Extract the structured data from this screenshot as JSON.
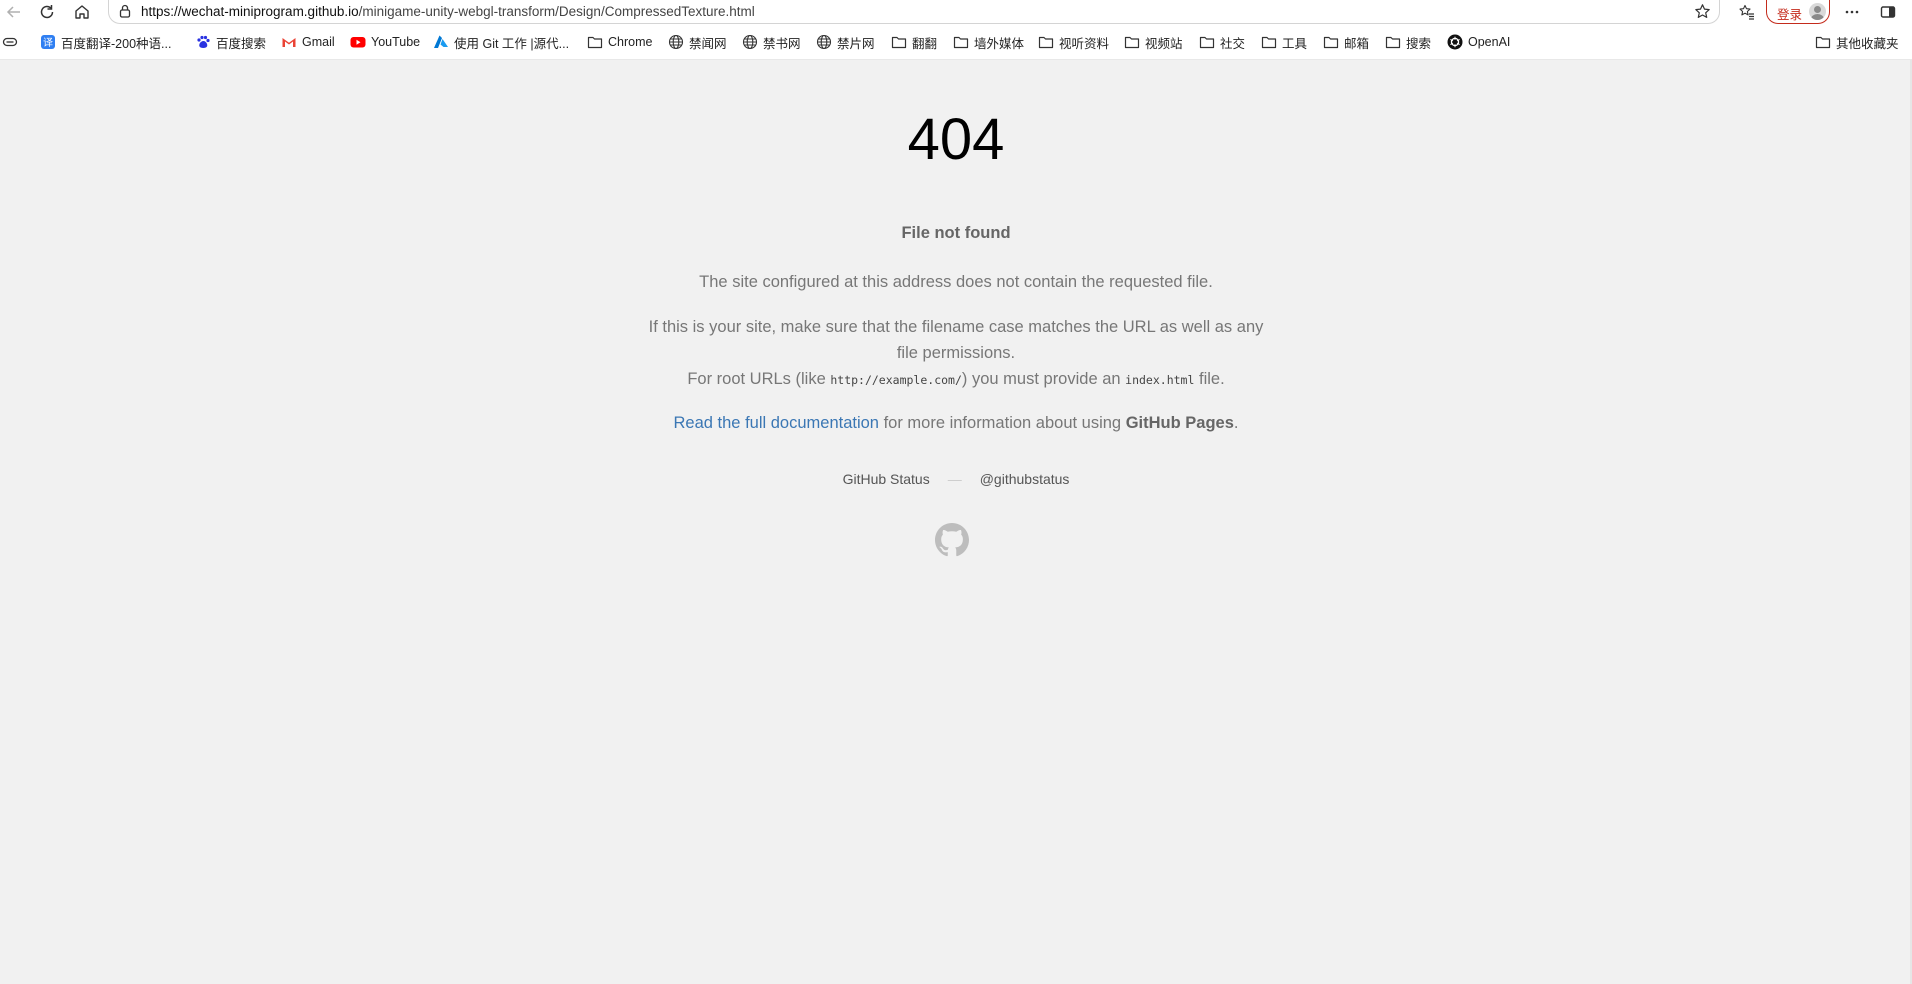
{
  "browser": {
    "url_host": "https://wechat-miniprogram.github.io",
    "url_path": "/minigame-unity-webgl-transform/Design/CompressedTexture.html",
    "login_label": "登录"
  },
  "icons": {
    "back": "arrow-left-icon",
    "reload": "reload-icon",
    "home": "home-icon",
    "lock": "lock-icon",
    "favorite": "star-icon",
    "favorites_menu": "favorites-icon",
    "more": "more-icon",
    "sidebar": "sidebar-icon",
    "github": "octocat-icon"
  },
  "bookmarks": [
    {
      "label": "百度翻译-200种语...",
      "icon": "translate-icon"
    },
    {
      "label": "百度搜索",
      "icon": "paw-icon"
    },
    {
      "label": "Gmail",
      "icon": "gmail-icon"
    },
    {
      "label": "YouTube",
      "icon": "youtube-icon"
    },
    {
      "label": "使用 Git 工作 |源代...",
      "icon": "azure-icon"
    },
    {
      "label": "Chrome",
      "icon": "folder-icon"
    },
    {
      "label": "禁闻网",
      "icon": "globe-icon"
    },
    {
      "label": "禁书网",
      "icon": "globe-icon"
    },
    {
      "label": "禁片网",
      "icon": "globe-icon"
    },
    {
      "label": "翻翻",
      "icon": "folder-icon"
    },
    {
      "label": "墙外媒体",
      "icon": "folder-icon"
    },
    {
      "label": "视听资料",
      "icon": "folder-icon"
    },
    {
      "label": "视频站",
      "icon": "folder-icon"
    },
    {
      "label": "社交",
      "icon": "folder-icon"
    },
    {
      "label": "工具",
      "icon": "folder-icon"
    },
    {
      "label": "邮箱",
      "icon": "folder-icon"
    },
    {
      "label": "搜索",
      "icon": "folder-icon"
    },
    {
      "label": "OpenAI",
      "icon": "openai-icon"
    }
  ],
  "other_bookmarks": "其他收藏夹",
  "page": {
    "code": "404",
    "title": "File not found",
    "p1": "The site configured at this address does not contain the requested file.",
    "p2_line1": "If this is your site, make sure that the filename case matches the URL as well as any",
    "p2_line2": "file permissions.",
    "p2_line3_a": "For root URLs (like ",
    "p2_code1": "http://example.com/",
    "p2_line3_b": ") you must provide an ",
    "p2_code2": "index.html",
    "p2_line3_c": " file.",
    "doc_link": "Read the full documentation",
    "p3_mid": " for more information about using ",
    "p3_strong": "GitHub Pages",
    "p3_end": ".",
    "footer_status": "GitHub Status",
    "footer_sep": "—",
    "footer_twitter": "@githubstatus"
  }
}
